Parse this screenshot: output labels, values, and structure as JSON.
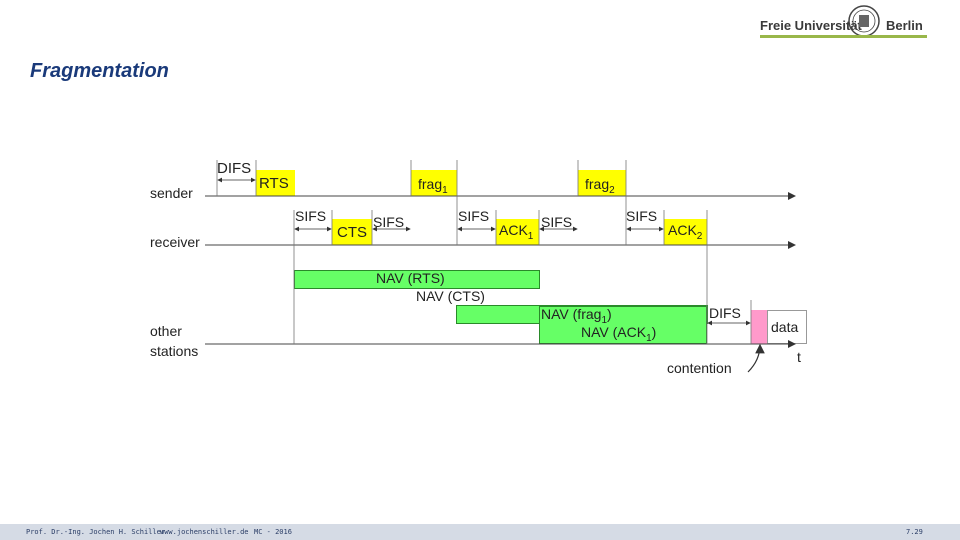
{
  "slide": {
    "title": "Fragmentation",
    "logo_left": "Freie Universität",
    "logo_right": "Berlin"
  },
  "rows": {
    "sender": "sender",
    "receiver": "receiver",
    "other1": "other",
    "other2": "stations"
  },
  "frames": {
    "difs_top": "DIFS",
    "rts": "RTS",
    "frag1": "frag",
    "frag1_sub": "1",
    "frag2": "frag",
    "frag2_sub": "2",
    "sifs1": "SIFS",
    "cts": "CTS",
    "sifs2": "SIFS",
    "sifs3": "SIFS",
    "ack1": "ACK",
    "ack1_sub": "1",
    "sifs4": "SIFS",
    "sifs5": "SIFS",
    "ack2": "ACK",
    "ack2_sub": "2"
  },
  "nav": {
    "rts": "NAV (RTS)",
    "cts": "NAV (CTS)",
    "frag1_a": "NAV (frag",
    "frag1_sub": "1",
    "frag1_b": ")",
    "ack1_a": "NAV (ACK",
    "ack1_sub": "1",
    "ack1_b": ")"
  },
  "contention": {
    "difs": "DIFS",
    "data": "data",
    "t": "t",
    "contention": "contention"
  },
  "colors": {
    "frame_yellow": "#ffff00",
    "nav_green": "#66ff66",
    "data_pink": "#ff9acb",
    "title_blue": "#1a3a7a",
    "accent_green": "#99b74a"
  },
  "footer": {
    "author": "Prof. Dr.-Ing. Jochen H. Schiller",
    "site": "www.jochenschiller.de",
    "course": "MC - 2016",
    "page": "7.29"
  }
}
